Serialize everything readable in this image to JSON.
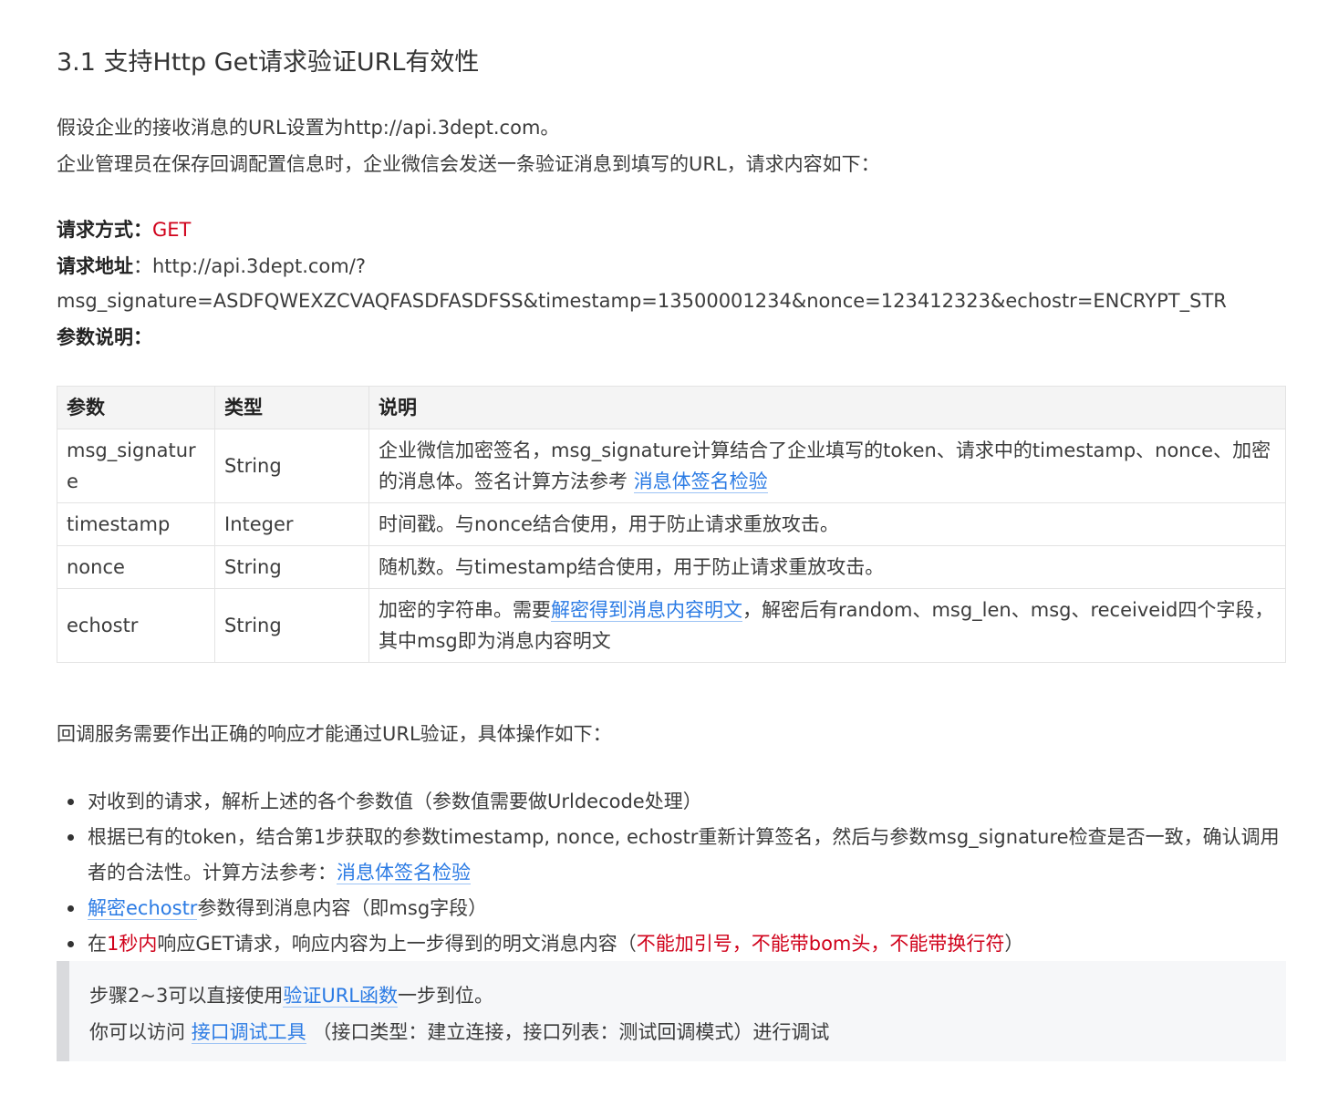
{
  "heading": "3.1 支持Http Get请求验证URL有效性",
  "intro": {
    "line1": "假设企业的接收消息的URL设置为http://api.3dept.com。",
    "line2": "企业管理员在保存回调配置信息时，企业微信会发送一条验证消息到填写的URL，请求内容如下："
  },
  "request": {
    "method_label": "请求方式：",
    "method_value": "GET",
    "url_label": "请求地址",
    "url_sep": "：http://api.3dept.com/?",
    "url_query": "msg_signature=ASDFQWEXZCVAQFASDFASDFSS&timestamp=13500001234&nonce=123412323&echostr=ENCRYPT_STR",
    "params_label": "参数说明："
  },
  "table": {
    "headers": [
      "参数",
      "类型",
      "说明"
    ],
    "rows": [
      {
        "name": "msg_signature",
        "type": "String",
        "desc_pre": "企业微信加密签名，msg_signature计算结合了企业填写的token、请求中的timestamp、nonce、加密的消息体。签名计算方法参考 ",
        "desc_link": "消息体签名检验",
        "desc_post": ""
      },
      {
        "name": "timestamp",
        "type": "Integer",
        "desc_pre": "时间戳。与nonce结合使用，用于防止请求重放攻击。",
        "desc_link": "",
        "desc_post": ""
      },
      {
        "name": "nonce",
        "type": "String",
        "desc_pre": "随机数。与timestamp结合使用，用于防止请求重放攻击。",
        "desc_link": "",
        "desc_post": ""
      },
      {
        "name": "echostr",
        "type": "String",
        "desc_pre": "加密的字符串。需要",
        "desc_link": "解密得到消息内容明文",
        "desc_post": "，解密后有random、msg_len、msg、receiveid四个字段，其中msg即为消息内容明文"
      }
    ]
  },
  "response_intro": "回调服务需要作出正确的响应才能通过URL验证，具体操作如下：",
  "steps": {
    "s1": "对收到的请求，解析上述的各个参数值（参数值需要做Urldecode处理）",
    "s2_pre": "根据已有的token，结合第1步获取的参数timestamp, nonce, echostr重新计算签名，然后与参数msg_signature检查是否一致，确认调用者的合法性。计算方法参考：",
    "s2_link": "消息体签名检验",
    "s3_link": "解密echostr",
    "s3_post": "参数得到消息内容（即msg字段）",
    "s4_a": "在",
    "s4_red1": "1秒内",
    "s4_b": "响应GET请求，响应内容为上一步得到的明文消息内容（",
    "s4_red2": "不能加引号，不能带bom头，不能带换行符",
    "s4_c": "）"
  },
  "note": {
    "l1_pre": "步骤2~3可以直接使用",
    "l1_link": "验证URL函数",
    "l1_post": "一步到位。",
    "l2_pre": "你可以访问 ",
    "l2_link": "接口调试工具",
    "l2_post": " （接口类型：建立连接，接口列表：测试回调模式）进行调试"
  },
  "colors": {
    "accent_link": "#2b7be4",
    "emphasis_red": "#d0021b"
  }
}
